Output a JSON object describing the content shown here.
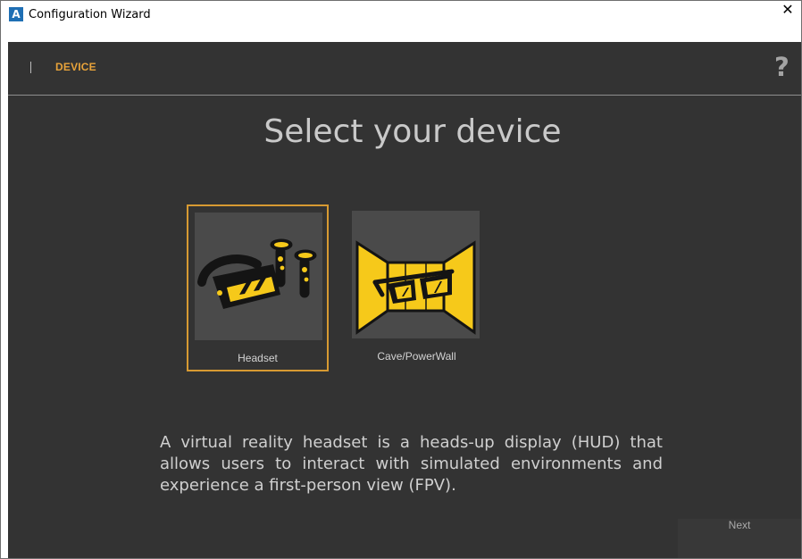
{
  "window": {
    "title": "Configuration Wizard",
    "app_icon_letter": "A",
    "close_glyph": "✕"
  },
  "wizard": {
    "step_separator": "|",
    "step_label": "DEVICE",
    "help_glyph": "?",
    "page_title": "Select your device",
    "devices": [
      {
        "label": "Headset",
        "icon": "vr-headset-icon",
        "selected": true
      },
      {
        "label": "Cave/PowerWall",
        "icon": "cave-powerwall-icon",
        "selected": false
      }
    ],
    "description": "A virtual reality headset is a heads-up display (HUD) that allows users to interact with simulated environments and experience a first-person view (FPV).",
    "next_label": "Next"
  },
  "colors": {
    "accent": "#d79a32",
    "background": "#333333",
    "icon_yellow": "#f6c91a"
  }
}
